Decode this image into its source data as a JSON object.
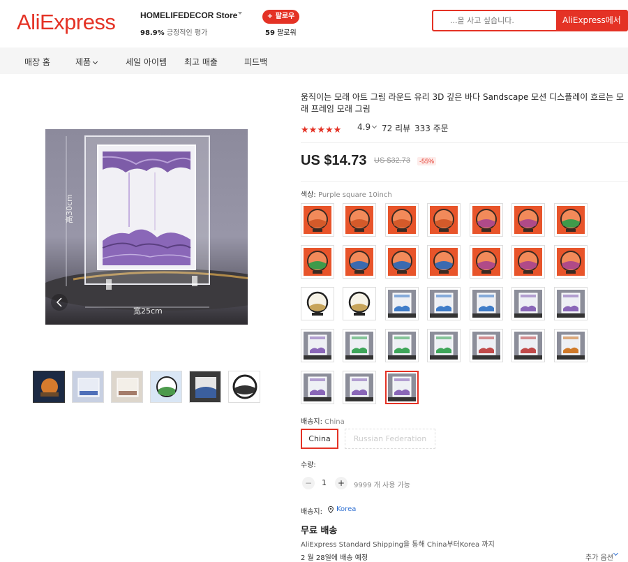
{
  "header": {
    "logo": "AliExpress",
    "store_name": "HOMELIFEDECOR Store",
    "rating_pct": "98.9%",
    "rating_text": "긍정적인 평가",
    "follow_label": "+ 팔로우",
    "followers_count": "59",
    "followers_text": "팔로워",
    "search_placeholder": "...을 사고 싶습니다.",
    "search_button": "AliExpress에서"
  },
  "nav": {
    "items": [
      {
        "label": "매장 홈"
      },
      {
        "label": "제품"
      },
      {
        "label": "세일 아이템"
      },
      {
        "label": "최고 매출"
      },
      {
        "label": "피드백"
      }
    ]
  },
  "product": {
    "title": "움직이는 모래 아트 그림 라운드 유리 3D 깊은 바다 Sandscape 모션 디스플레이 흐르는 모래 프레임 모래 그림",
    "rating": "4.9",
    "reviews": "72 리뷰",
    "orders": "333 주문",
    "price": "US $14.73",
    "price_original": "US $32.73",
    "discount": "-55%",
    "main_image_labels": {
      "height": "高30cm",
      "width": "宽25cm"
    },
    "colors": {
      "star": "#e43225",
      "accent": "#e43225",
      "link": "#2e6fd1"
    }
  },
  "options": {
    "color_label": "색상:",
    "color_value": "Purple square 10inch",
    "ship_from_label": "배송지:",
    "ship_from_value": "China",
    "ship_options": [
      {
        "label": "China",
        "state": "active"
      },
      {
        "label": "Russian Federation",
        "state": "disabled"
      }
    ],
    "qty_label": "수량:",
    "qty_value": "1",
    "qty_minus": "−",
    "qty_plus": "+",
    "qty_available": "9999 개 사용 가능"
  },
  "shipping": {
    "dest_label": "배송지:",
    "dest_value": "Korea",
    "free_shipping": "무료 배송",
    "method": "AliExpress Standard Shipping을 통해 China부터Korea 까지",
    "delivery": "2 월 28일에 배송 예정",
    "more_options": "추가 옵션"
  }
}
